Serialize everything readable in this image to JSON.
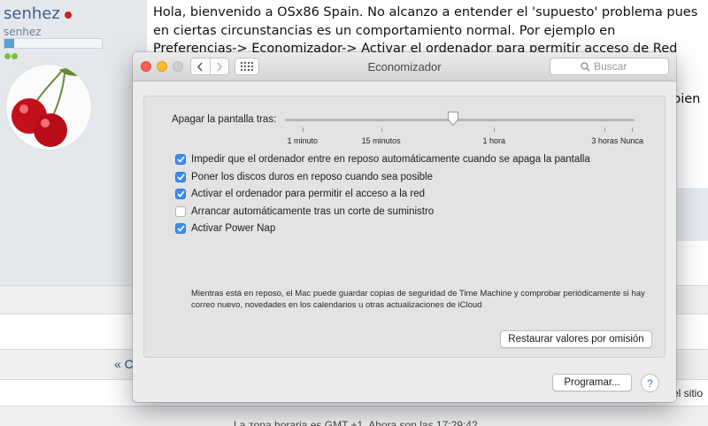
{
  "forum": {
    "username": "senhez",
    "user_title": "senhez",
    "reputation_fraction": 0.1,
    "post_text": "Hola, bienvenido a OSx86 Spain. No alcanzo a entender el 'supuesto' problema pues en ciertas circunstancias es un comportamiento normal. Por ejemplo en Preferencias-> Economizador-> Activar el ordenador para permitir acceso de Red",
    "post_cut": "bien",
    "nav_prev": "« C",
    "site_cut": "el sitio",
    "footer": "La zona horaria es GMT +1. Ahora son las 17:29:42."
  },
  "window": {
    "title": "Economizador",
    "search_placeholder": "Buscar",
    "slider": {
      "label": "Apagar la pantalla tras:",
      "value_fraction": 0.48,
      "ticks": [
        {
          "label": "1 minuto",
          "pos": 0.05
        },
        {
          "label": "15 minutos",
          "pos": 0.275
        },
        {
          "label": "1 hora",
          "pos": 0.598
        },
        {
          "label": "3 horas",
          "pos": 0.915
        },
        {
          "label": "Nunca",
          "pos": 0.992
        }
      ]
    },
    "options": [
      {
        "label": "Impedir que el ordenador entre en reposo automáticamente cuando se apaga la pantalla",
        "checked": true
      },
      {
        "label": "Poner los discos duros en reposo cuando sea posible",
        "checked": true
      },
      {
        "label": "Activar el ordenador para permitir el acceso a la red",
        "checked": true
      },
      {
        "label": "Arrancar automáticamente tras un corte de suministro",
        "checked": false
      },
      {
        "label": "Activar Power Nap",
        "checked": true
      }
    ],
    "power_nap_description": "Mientras está en reposo, el Mac puede guardar copias de seguridad de Time Machine y comprobar periódicamente si hay correo nuevo, novedades en los calendarios u otras actualizaciones de iCloud",
    "restore_button": "Restaurar valores por omisión",
    "schedule_button": "Programar...",
    "help_label": "?"
  },
  "colors": {
    "accent": "#3b8df5",
    "close": "#fc5f57",
    "minimize": "#fdbc2e",
    "forum_link": "#3d5f8a"
  }
}
